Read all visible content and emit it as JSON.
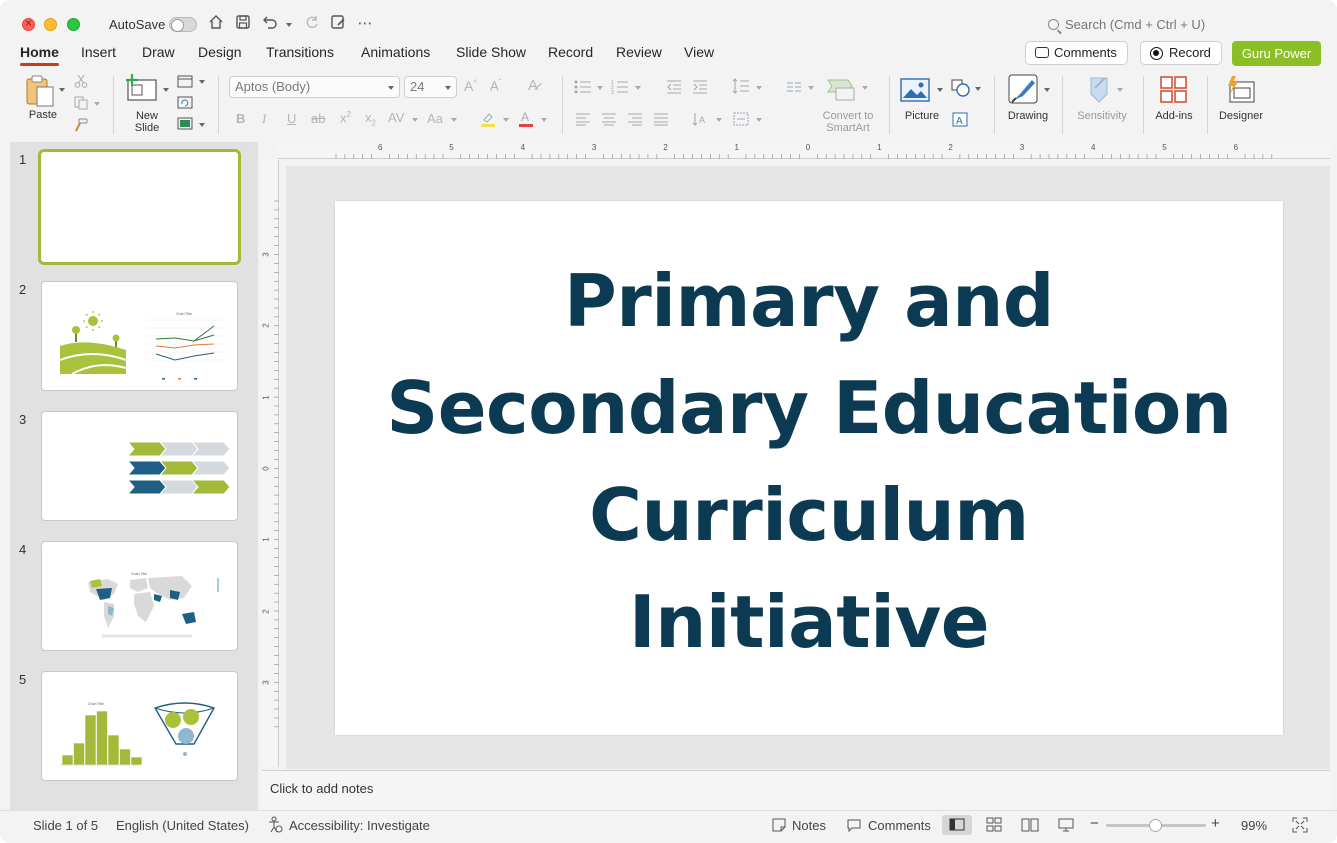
{
  "titlebar": {
    "autosave_label": "AutoSave",
    "search_placeholder": "Search (Cmd + Ctrl + U)"
  },
  "tabs": [
    {
      "label": "Home",
      "active": true
    },
    {
      "label": "Insert"
    },
    {
      "label": "Draw"
    },
    {
      "label": "Design"
    },
    {
      "label": "Transitions"
    },
    {
      "label": "Animations"
    },
    {
      "label": "Slide Show"
    },
    {
      "label": "Record"
    },
    {
      "label": "Review"
    },
    {
      "label": "View"
    }
  ],
  "top_buttons": {
    "comments": "Comments",
    "record": "Record",
    "guru": "Guru Power",
    "guru_color": "#8cbf26"
  },
  "ribbon": {
    "paste": "Paste",
    "new_slide": "New\nSlide",
    "font_name": "Aptos (Body)",
    "font_size": "24",
    "convert_smartart": "Convert to\nSmartArt",
    "picture": "Picture",
    "drawing": "Drawing",
    "sensitivity": "Sensitivity",
    "addins": "Add-ins",
    "designer": "Designer"
  },
  "slides": [
    {
      "number": "1",
      "selected": true,
      "kind": "title"
    },
    {
      "number": "2",
      "kind": "line-chart",
      "chart_title": "Chart Title"
    },
    {
      "number": "3",
      "kind": "chevrons"
    },
    {
      "number": "4",
      "kind": "map",
      "chart_title": "Chart Title"
    },
    {
      "number": "5",
      "kind": "histogram",
      "chart_title": "Chart Title"
    }
  ],
  "ruler": {
    "top_numbers": [
      "6",
      "5",
      "4",
      "3",
      "2",
      "1",
      "0",
      "1",
      "2",
      "3",
      "4",
      "5",
      "6"
    ],
    "left_numbers": [
      "3",
      "2",
      "1",
      "0",
      "1",
      "2",
      "3"
    ]
  },
  "slide_content": {
    "title_lines": [
      "Primary and",
      "Secondary Education",
      "Curriculum",
      "Initiative"
    ],
    "title_color": "#0b3a52"
  },
  "notes": {
    "placeholder": "Click to add notes"
  },
  "status": {
    "slide_indicator": "Slide 1 of 5",
    "language": "English (United States)",
    "accessibility": "Accessibility: Investigate",
    "notes": "Notes",
    "comments": "Comments",
    "zoom": "99%",
    "zoom_fraction": 0.49
  },
  "colors": {
    "accent_red": "#c43e1c",
    "green": "#a2b93a",
    "navy": "#1f5f86",
    "lightgray": "#d4d9de"
  }
}
